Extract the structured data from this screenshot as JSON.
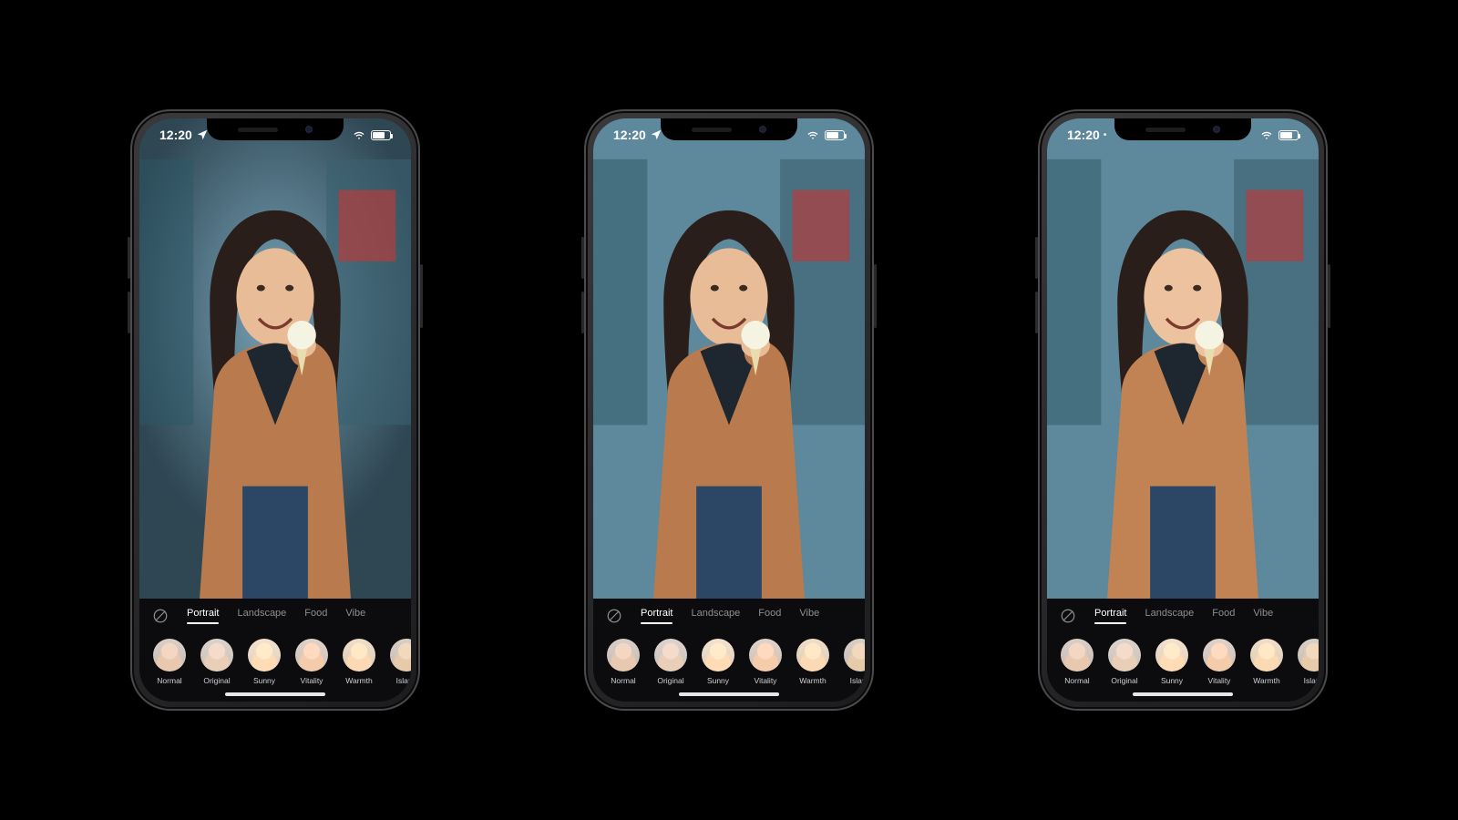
{
  "status": {
    "time": "12:20",
    "location_arrow": "↗"
  },
  "categories": {
    "items": [
      {
        "label": "Portrait",
        "active": true
      },
      {
        "label": "Landscape",
        "active": false
      },
      {
        "label": "Food",
        "active": false
      },
      {
        "label": "Vibe",
        "active": false
      }
    ]
  },
  "filters": {
    "items": [
      {
        "label": "Normal"
      },
      {
        "label": "Original"
      },
      {
        "label": "Sunny"
      },
      {
        "label": "Vitality"
      },
      {
        "label": "Warmth"
      },
      {
        "label": "Island"
      }
    ]
  }
}
